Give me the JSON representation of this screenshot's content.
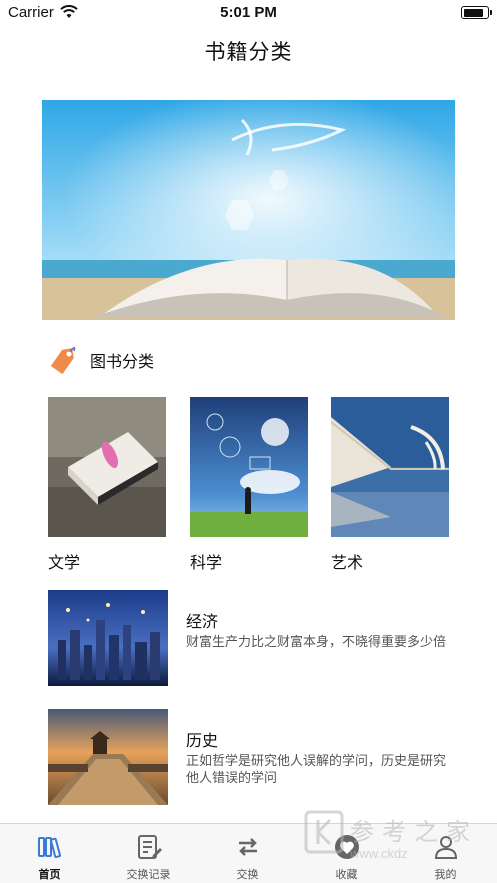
{
  "status_bar": {
    "carrier": "Carrier",
    "time": "5:01 PM",
    "battery_level": 0.9
  },
  "nav": {
    "title": "书籍分类"
  },
  "section": {
    "title": "图书分类"
  },
  "grid": [
    {
      "label": "文学"
    },
    {
      "label": "科学"
    },
    {
      "label": "艺术"
    }
  ],
  "list": [
    {
      "title": "经济",
      "description": "财富生产力比之财富本身，不晓得重要多少倍"
    },
    {
      "title": "历史",
      "description": "正如哲学是研究他人误解的学问，历史是研究他人错误的学问"
    }
  ],
  "tabs": [
    {
      "label": "首页",
      "icon": "books-icon",
      "active": true
    },
    {
      "label": "交换记录",
      "icon": "edit-document-icon",
      "active": false
    },
    {
      "label": "交换",
      "icon": "swap-arrows-icon",
      "active": false
    },
    {
      "label": "收藏",
      "icon": "heart-icon",
      "active": false
    },
    {
      "label": "我的",
      "icon": "person-icon",
      "active": false
    }
  ],
  "watermark": {
    "text": "参考之家",
    "url": "www.ckdz"
  },
  "colors": {
    "accent": "#3a7bd5",
    "tab_bg": "#f7f7f7",
    "tag_icon": "#f08a4b"
  }
}
